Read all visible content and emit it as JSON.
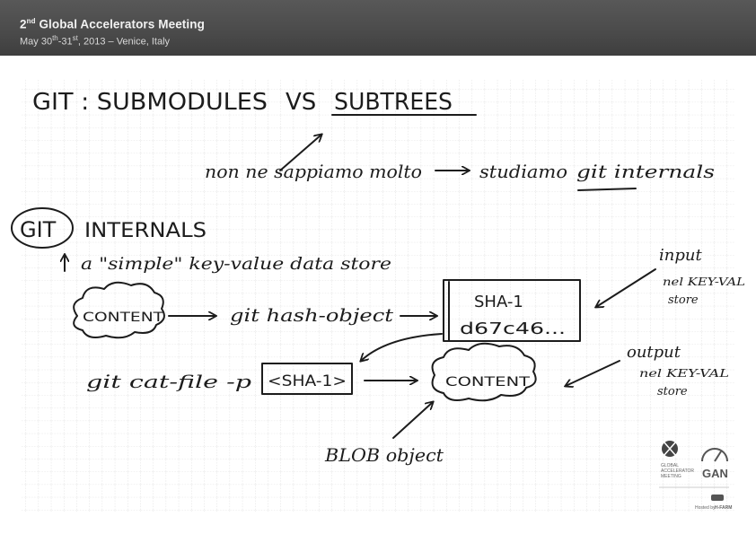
{
  "header": {
    "title_prefix": "2",
    "title_sup": "nd",
    "title_rest": " Global Accelerators Meeting",
    "dates_a": "May 30",
    "dates_a_sup": "th",
    "dates_b": "-31",
    "dates_b_sup": "st",
    "dates_rest": ", 2013 – Venice, Italy"
  },
  "notes": {
    "heading_left": "GIT : SUBMODULES",
    "heading_vs": "VS",
    "heading_right": "SUBTREES",
    "line_italian_a": "non ne sappiamo molto",
    "line_italian_b": "studiamo",
    "line_italian_c": "git internals",
    "section_git": "GIT",
    "section_internals": "INTERNALS",
    "description": "a \"simple\" key-value data store",
    "content_cloud_1": "CONTENT",
    "hash_command": "git hash-object",
    "sha_label": "SHA-1",
    "sha_value": "d67c46...",
    "input_note_1": "input",
    "input_note_2": "nel KEY-VAL",
    "input_note_3": "store",
    "cat_command": "git cat-file -p",
    "sha_arg": "<SHA-1>",
    "content_cloud_2": "CONTENT",
    "output_note_1": "output",
    "output_note_2": "nel KEY-VAL",
    "output_note_3": "store",
    "blob_label": "BLOB object"
  },
  "footer": {
    "gam_line_1": "GLOBAL",
    "gam_line_2": "ACCELERATOR",
    "gam_line_3": "MEETING",
    "gan_logo": "GAN",
    "hosted_by": "Hosted by",
    "host_name": "H-FARM"
  },
  "colors": {
    "header_bg": "#4a4a4a",
    "grid_line": "#c8c8c8",
    "ink": "#1c1c1c"
  }
}
